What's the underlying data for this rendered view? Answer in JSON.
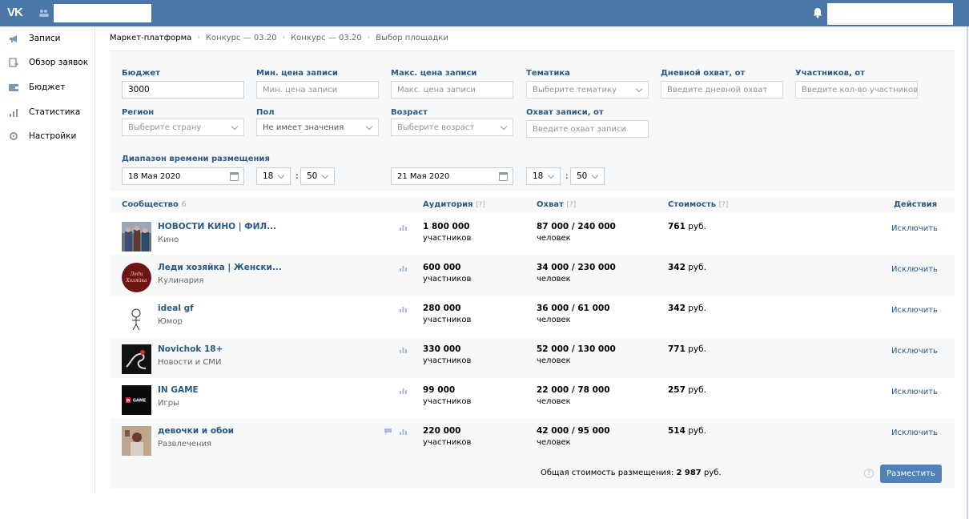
{
  "topbar": {
    "logo": "VK",
    "search_placeholder": ""
  },
  "sidebar": {
    "items": [
      {
        "label": "Записи",
        "icon": "megaphone-icon"
      },
      {
        "label": "Обзор заявок",
        "icon": "requests-icon"
      },
      {
        "label": "Бюджет",
        "icon": "wallet-icon"
      },
      {
        "label": "Статистика",
        "icon": "bar-chart-icon"
      },
      {
        "label": "Настройки",
        "icon": "gear-icon"
      }
    ]
  },
  "breadcrumb": [
    "Маркет-платформа",
    "Конкурс — 03.20",
    "Конкурс — 03.20",
    "Выбор площадки"
  ],
  "filters": {
    "budget": {
      "label": "Бюджет",
      "value": "3000"
    },
    "min_price": {
      "label": "Мин. цена записи",
      "placeholder": "Мин. цена записи"
    },
    "max_price": {
      "label": "Макс. цена записи",
      "placeholder": "Макс. цена записи"
    },
    "topic": {
      "label": "Тематика",
      "placeholder": "Выберите тематику"
    },
    "daily_reach": {
      "label": "Дневной охват, от",
      "placeholder": "Введите дневной охват"
    },
    "members": {
      "label": "Участников, от",
      "placeholder": "Введите кол-во участников"
    },
    "region": {
      "label": "Регион",
      "placeholder": "Выберите страну"
    },
    "gender": {
      "label": "Пол",
      "value": "Не имеет значения"
    },
    "age": {
      "label": "Возраст",
      "placeholder": "Выберите возраст"
    },
    "post_reach": {
      "label": "Охват записи, от",
      "placeholder": "Введите охват записи"
    },
    "range": {
      "label": "Диапазон времени размещения",
      "start_date": "18 Мая 2020",
      "start_hour": "18",
      "start_min": "50",
      "end_date": "21 Мая 2020",
      "end_hour": "18",
      "end_min": "50"
    }
  },
  "table": {
    "headers": {
      "community": "Сообщество",
      "count": "6",
      "audience": "Аудитория",
      "reach": "Охват",
      "cost": "Стоимость",
      "help": "[?]",
      "actions": "Действия"
    },
    "rows": [
      {
        "name": "НОВОСТИ КИНО | ФИЛ...",
        "category": "Кино",
        "audience": "1 800 000",
        "audience_unit": "участников",
        "reach": "87 000 / 240 000",
        "reach_unit": "человек",
        "cost": "761",
        "currency": "руб.",
        "action": "Исключить",
        "has_msg": false
      },
      {
        "name": "Леди хозяйка | Женски...",
        "category": "Кулинария",
        "audience": "600 000",
        "audience_unit": "участников",
        "reach": "34 000 / 230 000",
        "reach_unit": "человек",
        "cost": "342",
        "currency": "руб.",
        "action": "Исключить",
        "has_msg": false
      },
      {
        "name": "ideal gf",
        "category": "Юмор",
        "audience": "280 000",
        "audience_unit": "участников",
        "reach": "36 000 / 61 000",
        "reach_unit": "человек",
        "cost": "342",
        "currency": "руб.",
        "action": "Исключить",
        "has_msg": false
      },
      {
        "name": "Novichok 18+",
        "category": "Новости и СМИ",
        "audience": "330 000",
        "audience_unit": "участников",
        "reach": "52 000 / 130 000",
        "reach_unit": "человек",
        "cost": "771",
        "currency": "руб.",
        "action": "Исключить",
        "has_msg": false
      },
      {
        "name": "IN GAME",
        "category": "Игры",
        "audience": "99 000",
        "audience_unit": "участников",
        "reach": "22 000 / 78 000",
        "reach_unit": "человек",
        "cost": "257",
        "currency": "руб.",
        "action": "Исключить",
        "has_msg": false
      },
      {
        "name": "девочки и обои",
        "category": "Развлечения",
        "audience": "220 000",
        "audience_unit": "участников",
        "reach": "42 000 / 95 000",
        "reach_unit": "человек",
        "cost": "514",
        "currency": "руб.",
        "action": "Исключить",
        "has_msg": true
      }
    ]
  },
  "footer": {
    "total_label": "Общая стоимость размещения:",
    "total_value": "2 987",
    "currency": "руб.",
    "help": "?",
    "place_button": "Разместить"
  },
  "colors": {
    "header": "#4a76a8",
    "link": "#2a5885",
    "button": "#5181b8",
    "panel": "#f7f8fa"
  }
}
